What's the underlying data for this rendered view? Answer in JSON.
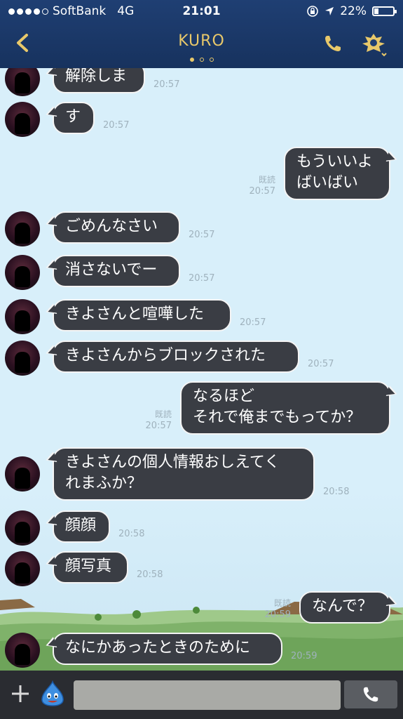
{
  "status": {
    "carrier": "SoftBank",
    "network": "4G",
    "time": "21:01",
    "battery": "22%",
    "signal_bars": 4
  },
  "header": {
    "title": "KURO",
    "back_icon": "chevron-left-icon",
    "call_icon": "phone-icon",
    "menu_icon": "crest-icon",
    "page_count": 3,
    "active_page": 1
  },
  "messages": [
    {
      "side": "in",
      "text": "解除しま",
      "time": "20:57"
    },
    {
      "side": "in",
      "text": "す",
      "time": "20:57"
    },
    {
      "side": "out",
      "lines": [
        "もういいよ",
        "ばいばい"
      ],
      "read": "既読",
      "time": "20:57"
    },
    {
      "side": "in",
      "text": "ごめんなさい",
      "time": "20:57"
    },
    {
      "side": "in",
      "text": "消さないでー",
      "time": "20:57"
    },
    {
      "side": "in",
      "text": "きよさんと喧嘩した",
      "time": "20:57"
    },
    {
      "side": "in",
      "text": "きよさんからブロックされた",
      "time": "20:57"
    },
    {
      "side": "out",
      "lines": [
        "なるほど",
        "それで俺までもってか？"
      ],
      "read": "既読",
      "time": "20:57"
    },
    {
      "side": "in",
      "lines": [
        "きよさんの個人情報おしえてく",
        "れまふか？"
      ],
      "time": "20:58"
    },
    {
      "side": "in",
      "text": "顔顔",
      "time": "20:58"
    },
    {
      "side": "in",
      "text": "顔写真",
      "time": "20:58"
    },
    {
      "side": "out",
      "text": "なんで？",
      "read": "既読",
      "time": "20:59"
    },
    {
      "side": "in",
      "text": "なにかあったときのために",
      "time": "20:59"
    }
  ],
  "input": {
    "placeholder": "",
    "value": ""
  },
  "icons": {
    "plus": "plus-icon",
    "sticker": "slime-icon",
    "call": "phone-icon"
  },
  "colors": {
    "header_bg": "#1f3f73",
    "accent_gold": "#e8c86a",
    "bubble_bg": "#3a3d44",
    "chat_bg": "#d8effa",
    "input_bg": "#2a2c31"
  }
}
